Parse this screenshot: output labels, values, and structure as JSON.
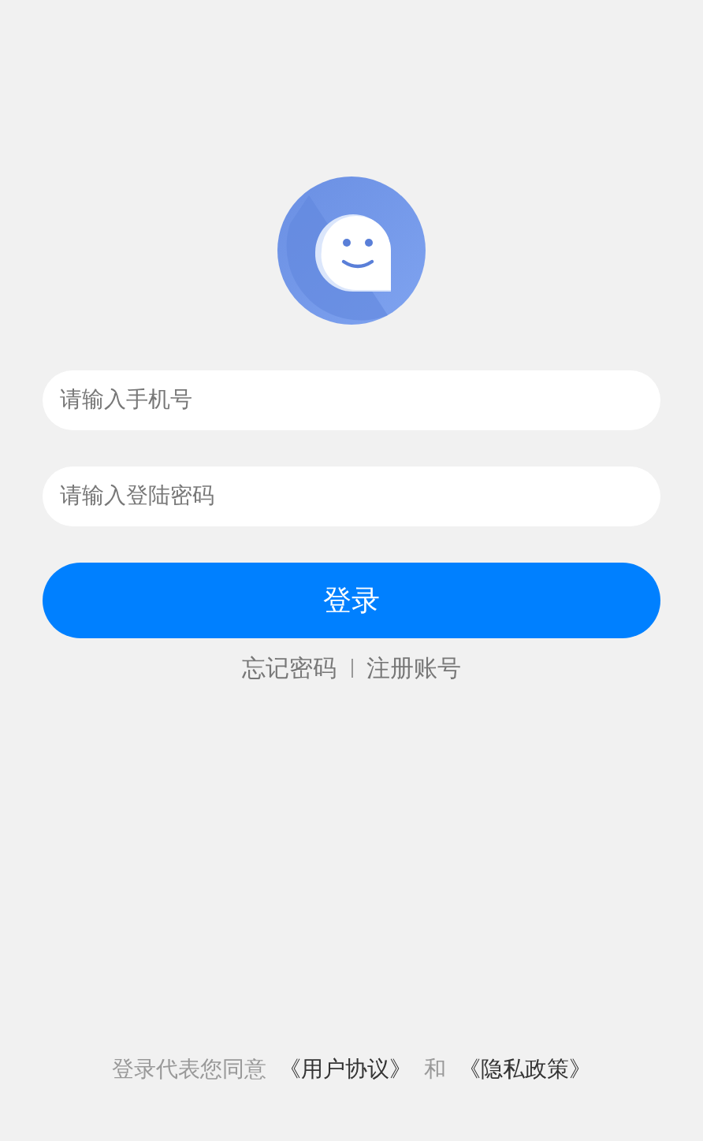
{
  "login_form": {
    "phone_field": {
      "placeholder": "请输入手机号"
    },
    "password_field": {
      "placeholder": "请输入登陆密码"
    },
    "submit_button": "登录",
    "links": [
      "忘记密码",
      "注册账号"
    ]
  },
  "agreement": {
    "prefix": "登录代表您同意",
    "user_agreement": "《用户协议》",
    "joiner": "和",
    "privacy_policy": "《隐私政策》"
  }
}
